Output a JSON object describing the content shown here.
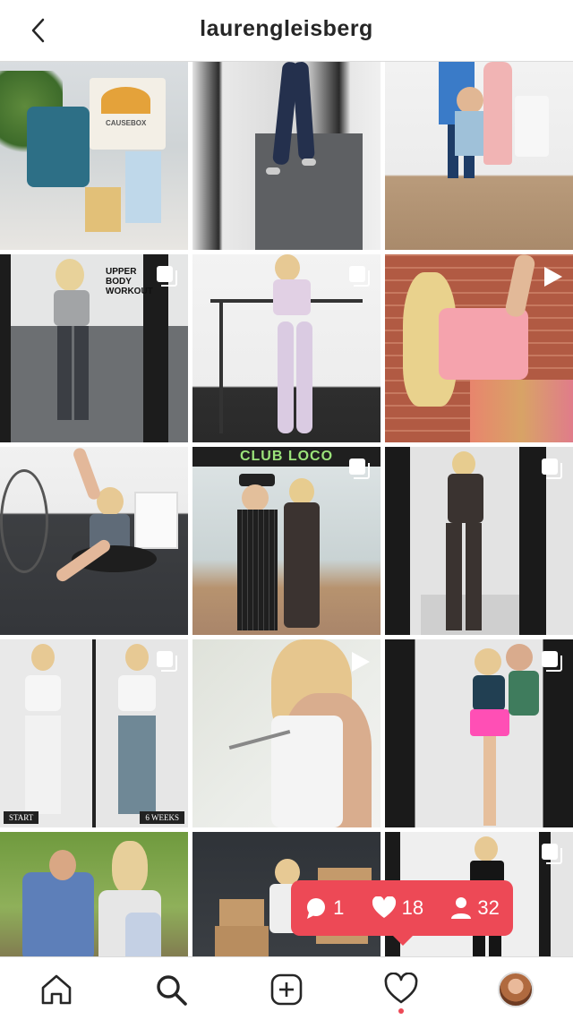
{
  "header": {
    "title": "laurengleisberg",
    "back_icon": "chevron-left-icon"
  },
  "grid": {
    "tiles": [
      {
        "id": "t1",
        "badge": "none",
        "text": "CAUSEBOX"
      },
      {
        "id": "t2",
        "badge": "none"
      },
      {
        "id": "t3",
        "badge": "none"
      },
      {
        "id": "t4",
        "badge": "carousel",
        "text": "UPPER BODY WORKOUT"
      },
      {
        "id": "t5",
        "badge": "carousel"
      },
      {
        "id": "t6",
        "badge": "video"
      },
      {
        "id": "t7",
        "badge": "none"
      },
      {
        "id": "t8",
        "badge": "carousel",
        "text": "CLUB LOCO"
      },
      {
        "id": "t9",
        "badge": "carousel"
      },
      {
        "id": "t10",
        "badge": "carousel",
        "text_start": "START",
        "text_weeks": "6 WEEKS"
      },
      {
        "id": "t11",
        "badge": "video"
      },
      {
        "id": "t12",
        "badge": "carousel"
      },
      {
        "id": "t13",
        "badge": "none"
      },
      {
        "id": "t14",
        "badge": "none"
      },
      {
        "id": "t15",
        "badge": "carousel"
      }
    ]
  },
  "notification": {
    "comments": "1",
    "likes": "18",
    "followers": "32",
    "color": "#ed4956"
  },
  "bottom_nav": {
    "items": [
      "home-icon",
      "search-icon",
      "add-post-icon",
      "activity-heart-icon",
      "profile-avatar"
    ]
  }
}
